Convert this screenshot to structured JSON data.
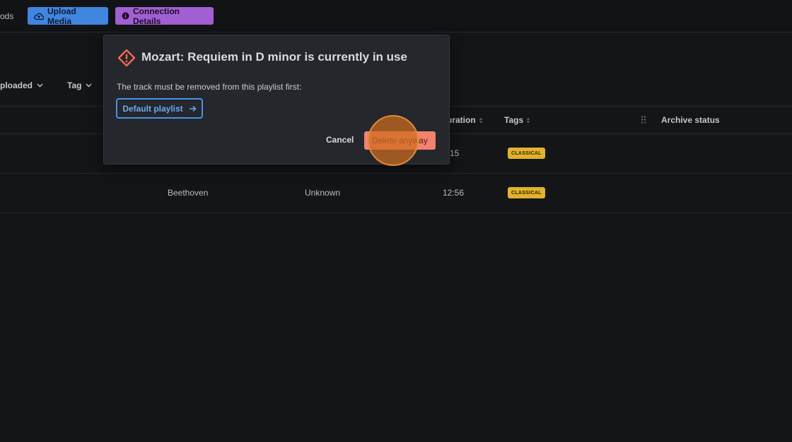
{
  "topbar": {
    "crumb": "ods",
    "upload_label": "Upload Media",
    "connection_label": "Connection Details"
  },
  "filters": {
    "uploaded_label": "ploaded",
    "tag_label": "Tag"
  },
  "table": {
    "headers": {
      "duration": "uration",
      "tags": "Tags",
      "archive": "Archive status"
    },
    "rows": [
      {
        "artist": "",
        "album": "",
        "duration": "5:15",
        "tag": "CLASSICAL"
      },
      {
        "artist": "Beethoven",
        "album": "Unknown",
        "duration": "12:56",
        "tag": "CLASSICAL"
      }
    ]
  },
  "modal": {
    "title": "Mozart: Requiem in D minor is currently in use",
    "message": "The track must be removed from this playlist first:",
    "playlist_label": "Default playlist",
    "cancel_label": "Cancel",
    "delete_label": "Delete anyway"
  },
  "colors": {
    "accent_blue": "#3f86e0",
    "accent_purple": "#a25fd3",
    "warning": "#f26b4f",
    "badge": "#e2b32a",
    "danger_button": "#f2826e"
  }
}
